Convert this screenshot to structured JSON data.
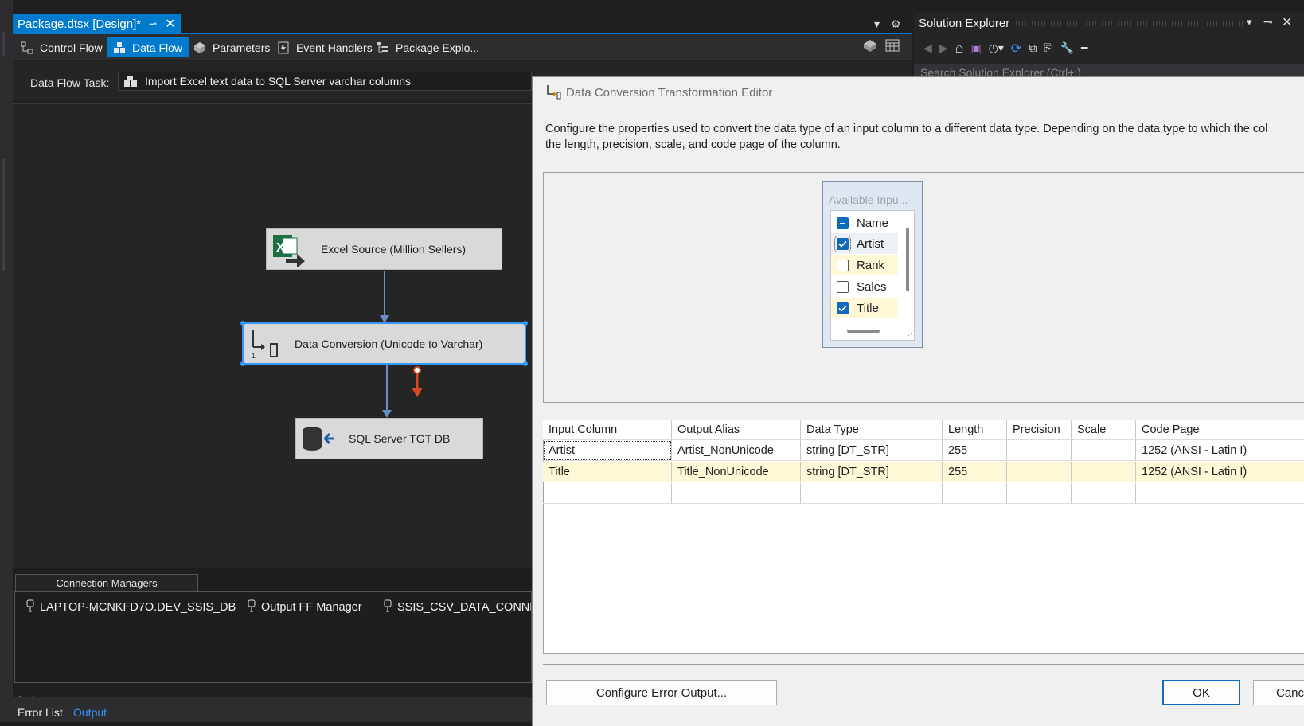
{
  "doc_tab": {
    "title": "Package.dtsx [Design]*",
    "pin": "⊸",
    "close": "✕"
  },
  "designer_tabs": [
    {
      "label": "Control Flow"
    },
    {
      "label": "Data Flow"
    },
    {
      "label": "Parameters"
    },
    {
      "label": "Event Handlers"
    },
    {
      "label": "Package Explo..."
    }
  ],
  "task": {
    "label": "Data Flow Task:",
    "value": "Import Excel text data to SQL Server varchar columns"
  },
  "nodes": {
    "source": "Excel Source (Million Sellers)",
    "conversion": "Data Conversion (Unicode to Varchar)",
    "target": "SQL Server TGT DB"
  },
  "connection_managers": {
    "tab": "Connection Managers",
    "items": [
      "LAPTOP-MCNKFD7O.DEV_SSIS_DB",
      "Output FF Manager",
      "SSIS_CSV_DATA_CONNE"
    ]
  },
  "bottom_tabs": {
    "clipped": "Output",
    "error_list": "Error List",
    "output": "Output"
  },
  "solution_explorer": {
    "title": "Solution Explorer",
    "search_placeholder": "Search Solution Explorer (Ctrl+;)"
  },
  "dialog": {
    "title": "Data Conversion Transformation Editor",
    "desc_line1": "Configure the properties used to convert the data type of an input column to a different data type. Depending on the data type to which the col",
    "desc_line2": "the length, precision, scale, and code page of the column.",
    "available_header": "Available Inpu...",
    "input_columns": [
      {
        "name": "Name",
        "state": "indeterminate"
      },
      {
        "name": "Artist",
        "state": "checked"
      },
      {
        "name": "Rank",
        "state": "unchecked"
      },
      {
        "name": "Sales",
        "state": "unchecked"
      },
      {
        "name": "Title",
        "state": "checked"
      }
    ],
    "grid": {
      "headers": [
        "Input Column",
        "Output Alias",
        "Data Type",
        "Length",
        "Precision",
        "Scale",
        "Code Page"
      ],
      "rows": [
        [
          "Artist",
          "Artist_NonUnicode",
          "string [DT_STR]",
          "255",
          "",
          "",
          "1252  (ANSI - Latin I)"
        ],
        [
          "Title",
          "Title_NonUnicode",
          "string [DT_STR]",
          "255",
          "",
          "",
          "1252  (ANSI - Latin I)"
        ]
      ]
    },
    "buttons": {
      "error_output": "Configure Error Output...",
      "ok": "OK",
      "cancel": "Canc"
    }
  },
  "colors": {
    "accent": "#007acc",
    "selection": "#3399ff",
    "error_path": "#d9481f",
    "path": "#6b8cc4",
    "row_highlight": "#fff8d6"
  }
}
